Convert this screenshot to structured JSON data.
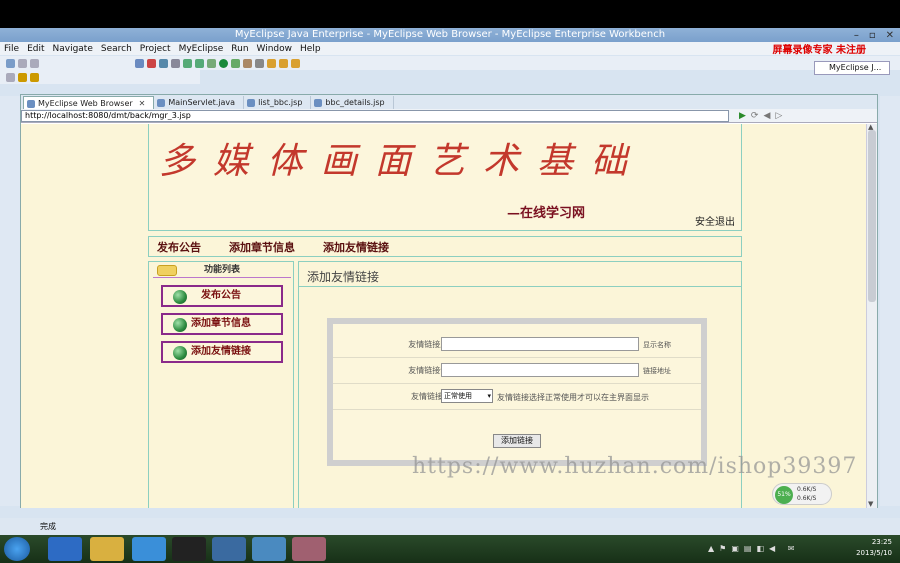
{
  "window": {
    "title": "MyEclipse Java Enterprise - MyEclipse Web Browser - MyEclipse Enterprise Workbench"
  },
  "menu": {
    "items": [
      "File",
      "Edit",
      "Navigate",
      "Search",
      "Project",
      "MyEclipse",
      "Run",
      "Window",
      "Help"
    ],
    "recorder_label": "屏幕录像专家  未注册"
  },
  "perspective": "MyEclipse J...",
  "tabs": [
    {
      "label": "MyEclipse Web Browser"
    },
    {
      "label": "MainServlet.java"
    },
    {
      "label": "list_bbc.jsp"
    },
    {
      "label": "bbc_details.jsp"
    }
  ],
  "url": "http://localhost:8080/dmt/back/mgr_3.jsp",
  "site": {
    "title": "多媒体画面艺术基础",
    "subtitle": "—在线学习网",
    "logout": "安全退出",
    "nav": [
      "发布公告",
      "添加章节信息",
      "添加友情链接"
    ],
    "sidebar_title": "功能列表",
    "sidebar_items": [
      "发布公告",
      "添加章节信息",
      "添加友情链接"
    ],
    "main_title": "添加友情链接",
    "form": {
      "name_label": "友情链接显示名称:",
      "name_value": "",
      "name_hint": "显示名称",
      "url_label": "友情链接询问链接:",
      "url_value": "",
      "url_hint": "链接地址",
      "use_label": "友情链接是否使用",
      "use_selected": "正常使用",
      "use_hint": "友情链接选择正常使用才可以在主界面显示",
      "submit": "添加链接"
    }
  },
  "watermark": "https://www.huzhan.com/ishop39397",
  "network": {
    "percent": "51%",
    "up": "0.6K/S",
    "down": "0.6K/S"
  },
  "status": {
    "text": "完成"
  },
  "clock": {
    "time": "23:25",
    "date": "2013/5/10"
  }
}
